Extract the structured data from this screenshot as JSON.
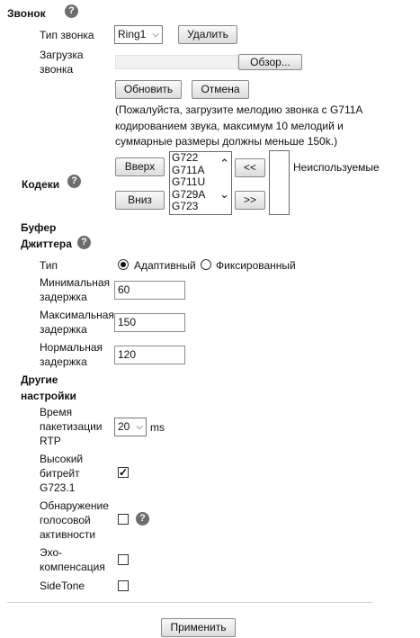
{
  "ringtone": {
    "title": "Звонок",
    "type_label": "Тип звонка",
    "type_value": "Ring1",
    "delete_label": "Удалить",
    "upload_label": "Загрузка звонка",
    "upload_label_line1": "Загрузка",
    "upload_label_line2": "звонка",
    "browse_label": "Обзор...",
    "update_label": "Обновить",
    "cancel_label": "Отмена",
    "note_line1": "(Пожалуйста, загрузите мелодию звонка с G711A",
    "note_line2": "кодированием звука, максимум 10 мелодий и",
    "note_line3": "суммарные размеры должны меньше 150k.)"
  },
  "codecs": {
    "title": "Кодеки",
    "up_label": "Вверх",
    "down_label": "Вниз",
    "move_left_label": "<<",
    "move_right_label": ">>",
    "used": [
      "G722",
      "G711A",
      "G711U",
      "G729A",
      "G723"
    ],
    "unused_label": "Неиспользуемые"
  },
  "jitter": {
    "title_line1": "Буфер",
    "title_line2": "Джиттера",
    "type_label": "Тип",
    "adaptive_label": "Адаптивный",
    "fixed_label": "Фиксированный",
    "selected": "adaptive",
    "min_label_line1": "Минимальная",
    "min_label_line2": "задержка",
    "min_value": "60",
    "max_label_line1": "Максимальная",
    "max_label_line2": "задержка",
    "max_value": "150",
    "norm_label_line1": "Нормальная",
    "norm_label_line2": "задержка",
    "norm_value": "120"
  },
  "other": {
    "title_line1": "Другие",
    "title_line2": "настройки",
    "rtp_label_line1": "Время",
    "rtp_label_line2": "пакетизации",
    "rtp_label_line3": "RTP",
    "rtp_value": "20",
    "rtp_unit": "ms",
    "g723_label_line1": "Высокий",
    "g723_label_line2": "битрейт",
    "g723_label_line3": "G723.1",
    "g723_checked": true,
    "vad_label_line1": "Обнаружение",
    "vad_label_line2": "голосовой",
    "vad_label_line3": "активности",
    "vad_checked": false,
    "echo_label_line1": "Эхо-",
    "echo_label_line2": "компенсация",
    "echo_checked": false,
    "sidetone_label": "SideTone",
    "sidetone_checked": false
  },
  "apply_label": "Применить",
  "icons": {
    "help": "help-icon",
    "check": "check-icon",
    "chevron": "chevron-down-icon"
  }
}
